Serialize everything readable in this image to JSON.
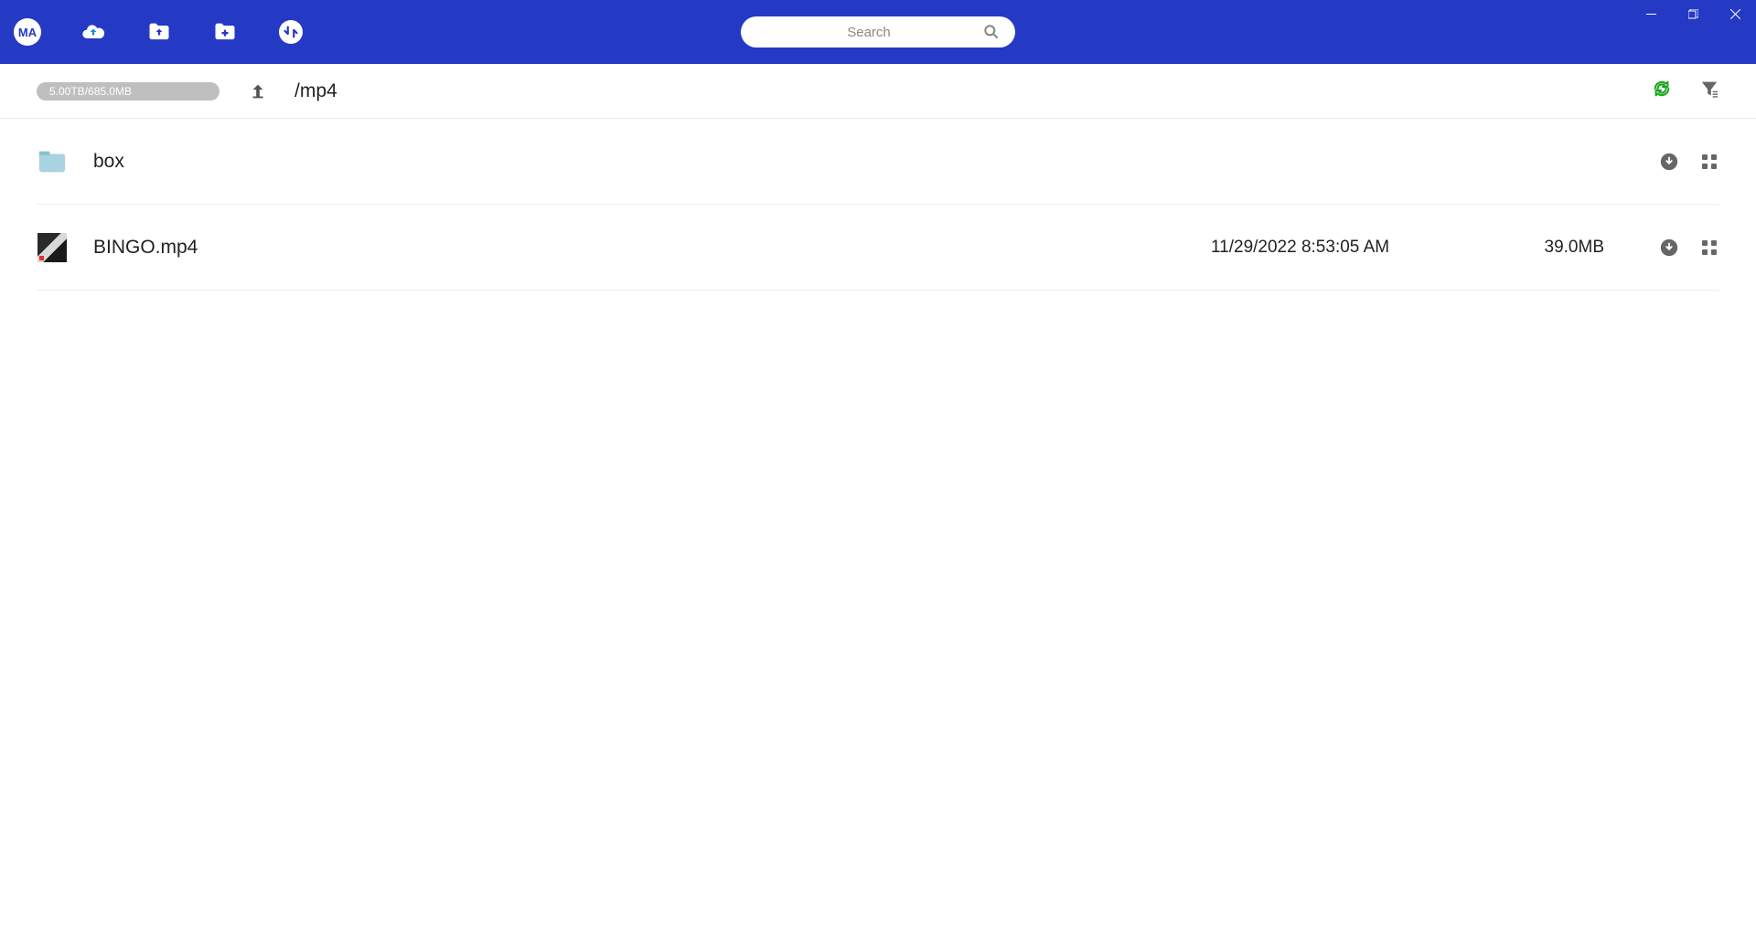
{
  "header": {
    "logo_text": "MA",
    "search_placeholder": "Search"
  },
  "subheader": {
    "quota_text": "5.00TB/685.0MB",
    "path": "/mp4"
  },
  "rows": [
    {
      "name": "box",
      "date": "",
      "size": ""
    },
    {
      "name": "BINGO.mp4",
      "date": "11/29/2022 8:53:05 AM",
      "size": "39.0MB"
    }
  ]
}
